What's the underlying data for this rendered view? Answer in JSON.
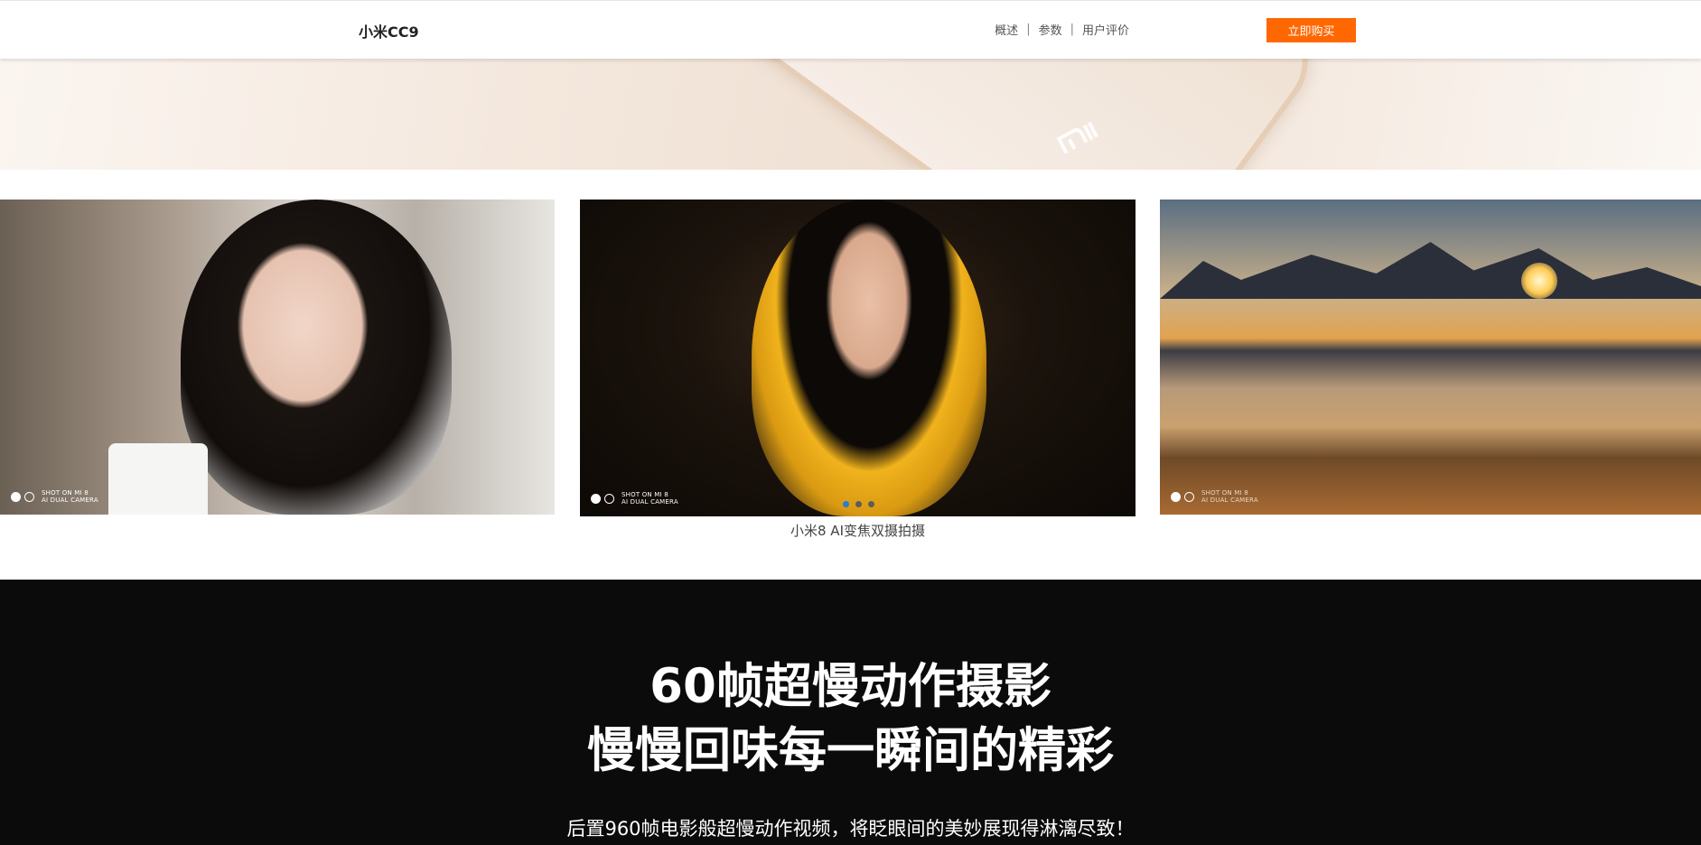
{
  "header": {
    "product_name": "小米CC9",
    "nav": [
      "概述",
      "参数",
      "用户评价"
    ],
    "separator": "|",
    "buy_button": "立即购买"
  },
  "carousel": {
    "caption": "小米8 AI变焦双摄拍摄",
    "photo_badge": [
      "SHOT ON MI 8",
      "AI DUAL CAMERA"
    ],
    "pager_count": 3,
    "active_index": 0,
    "accent_color": "#2a7bd6"
  },
  "feature": {
    "title_line1": "60帧超慢动作摄影",
    "title_line2": "慢慢回味每一瞬间的精彩",
    "description": "后置960帧电影般超慢动作视频，将眨眼间的美妙展现得淋漓尽致！"
  },
  "colors": {
    "buy_button": "#ff6700",
    "feature_background": "#0b0b0b"
  },
  "icons": [
    "mi-logo-icon"
  ]
}
